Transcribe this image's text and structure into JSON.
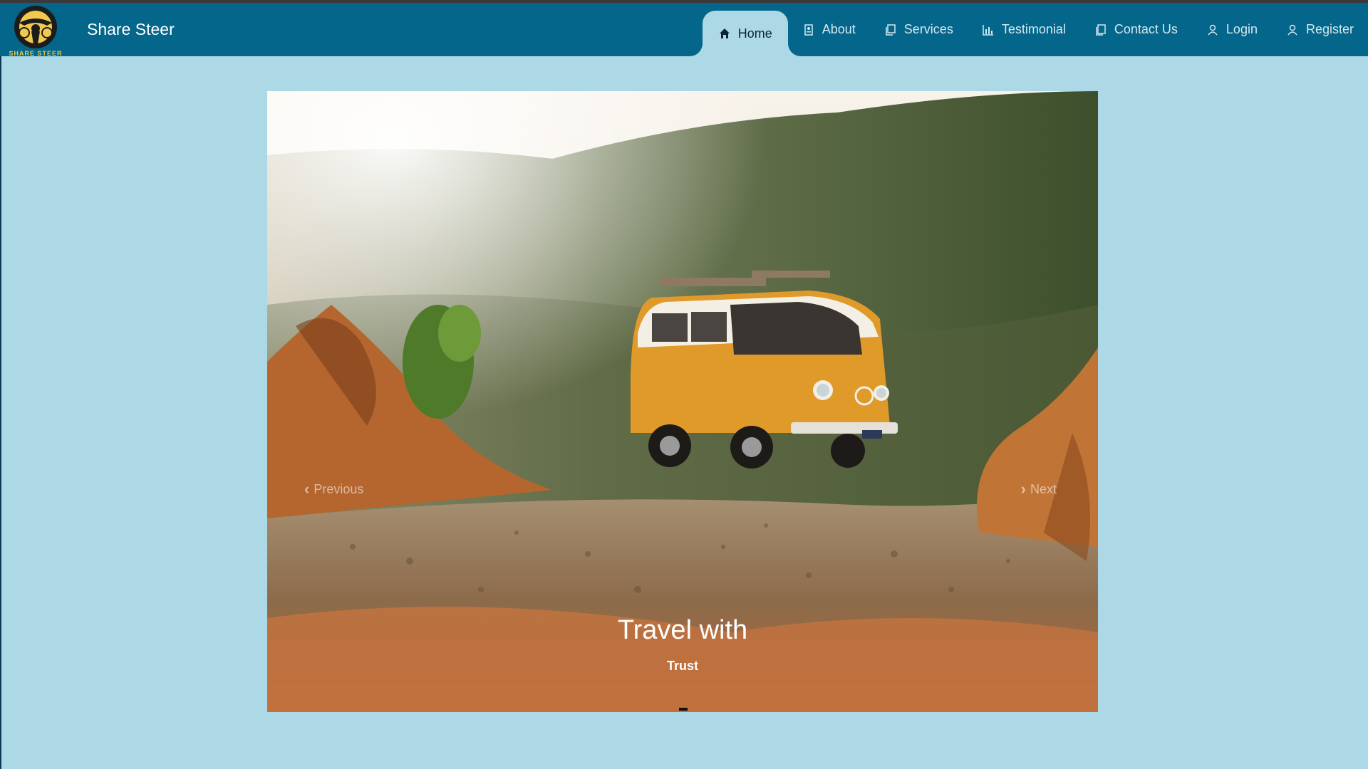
{
  "brand": {
    "name": "Share Steer",
    "logo_text": "SHARE STEER"
  },
  "nav": {
    "items": [
      {
        "label": "Home",
        "icon": "home-icon",
        "active": true
      },
      {
        "label": "About",
        "icon": "document-icon"
      },
      {
        "label": "Services",
        "icon": "copy-icon"
      },
      {
        "label": "Testimonial",
        "icon": "bar-chart-icon"
      },
      {
        "label": "Contact Us",
        "icon": "contact-icon"
      },
      {
        "label": "Login",
        "icon": "user-icon"
      },
      {
        "label": "Register",
        "icon": "user-icon"
      }
    ]
  },
  "carousel": {
    "prev_label": "Previous",
    "next_label": "Next",
    "caption_title": "Travel with",
    "caption_subtitle": "Trust"
  },
  "colors": {
    "navbar": "#03668a",
    "page_bg": "#add8e6",
    "van": "#e09a2a"
  }
}
